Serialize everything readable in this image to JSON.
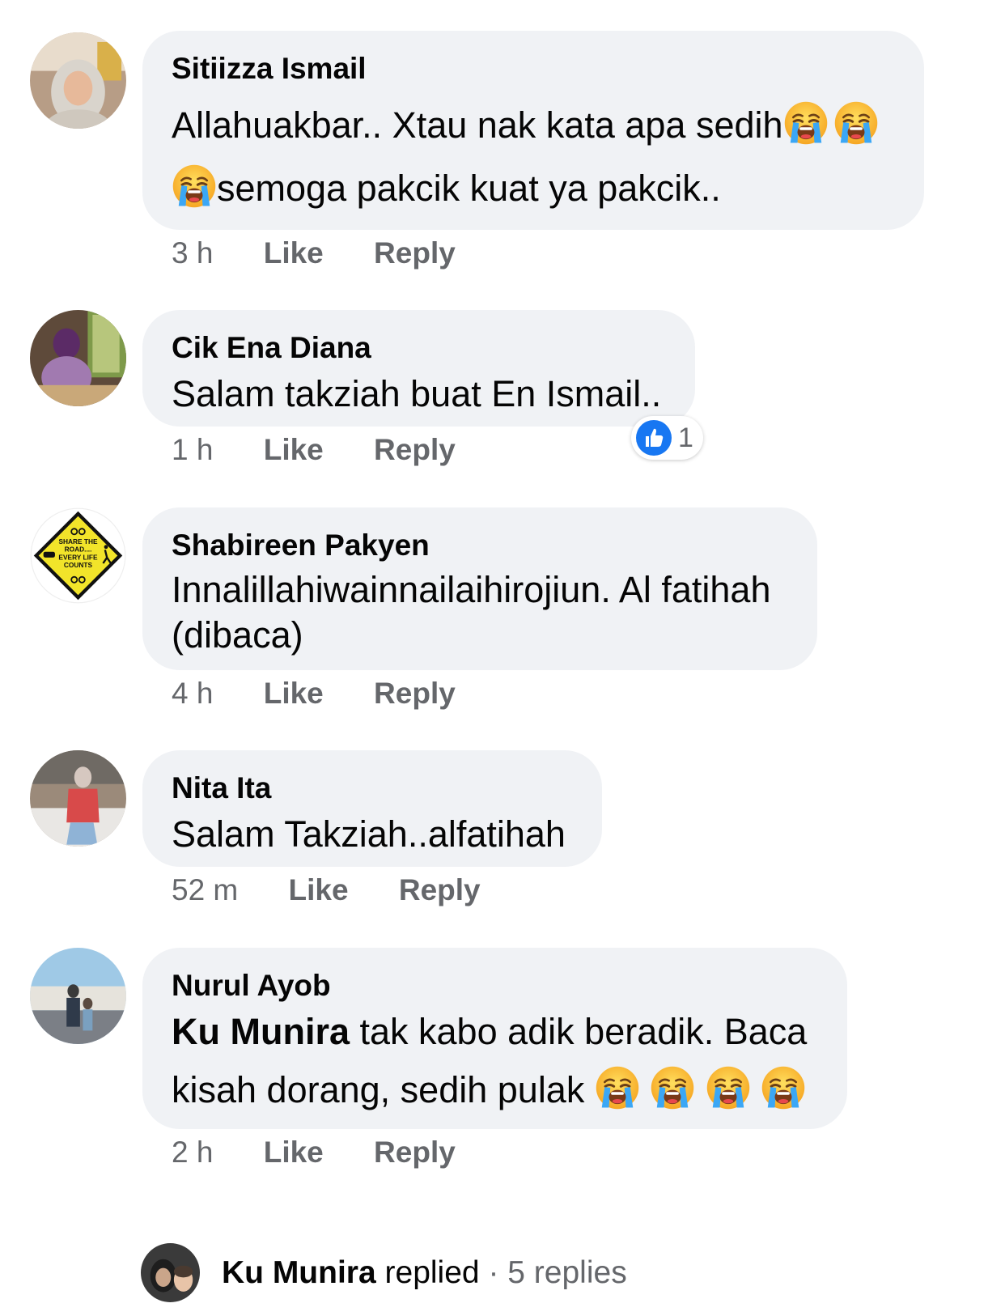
{
  "comments": [
    {
      "name": "Sitiizza Ismail",
      "line1": "Allahuakbar.. Xtau nak kata apa sedih",
      "line2": "semoga pakcik kuat ya pakcik..",
      "time": "3 h",
      "like": "Like",
      "reply": "Reply"
    },
    {
      "name": "Cik Ena Diana",
      "text": "Salam takziah buat En Ismail..",
      "time": "1 h",
      "like": "Like",
      "reply": "Reply",
      "reaction_count": "1"
    },
    {
      "name": "Shabireen Pakyen",
      "line1": "Innalillahiwainnailaihirojiun. Al fatihah",
      "line2": "(dibaca)",
      "time": "4 h",
      "like": "Like",
      "reply": "Reply",
      "avatar_sign": [
        "SHARE THE",
        "ROAD....",
        "EVERY LIFE",
        "COUNTS"
      ]
    },
    {
      "name": "Nita Ita",
      "text": "Salam Takziah..alfatihah",
      "time": "52 m",
      "like": "Like",
      "reply": "Reply"
    },
    {
      "name": "Nurul Ayob",
      "mention": "Ku Munira",
      "line1_rest": " tak kabo adik beradik. Baca",
      "line2": "kisah dorang, sedih pulak",
      "time": "2 h",
      "like": "Like",
      "reply": "Reply"
    }
  ],
  "replies_preview": {
    "name": "Ku Munira",
    "action": "replied",
    "separator": "·",
    "count": "5 replies"
  },
  "icons": {
    "emoji": "loudly-crying-face-icon",
    "reaction": "like-thumb-icon"
  },
  "colors": {
    "bubble": "#f0f2f5",
    "meta": "#65676b",
    "like_blue": "#1877f2"
  }
}
